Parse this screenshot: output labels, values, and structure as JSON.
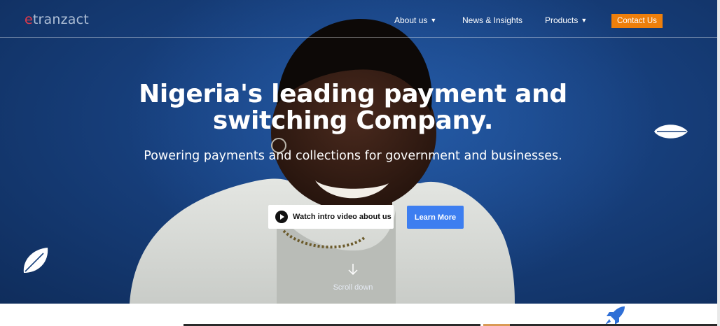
{
  "logo": {
    "prefix": "e",
    "rest": "tranzact"
  },
  "nav": {
    "about": "About us",
    "news": "News & Insights",
    "products": "Products",
    "contact": "Contact Us"
  },
  "hero": {
    "headline_line1": "Nigeria's leading payment and",
    "headline_line2": "switching Company.",
    "subheadline": "Powering payments and collections for government and businesses.",
    "video_button": "Watch intro video about us",
    "learn_button": "Learn More",
    "scroll_label": "Scroll down"
  },
  "colors": {
    "hero_blue": "#173f7c",
    "contact_orange": "#ee7f0b",
    "learn_blue": "#3d7ef0",
    "logo_red": "#e23a4a",
    "rocket_blue": "#2f6fd6"
  },
  "icons": [
    "chevron-down-icon",
    "play-icon",
    "arrow-down-icon",
    "leaf-icon",
    "rocket-icon"
  ]
}
